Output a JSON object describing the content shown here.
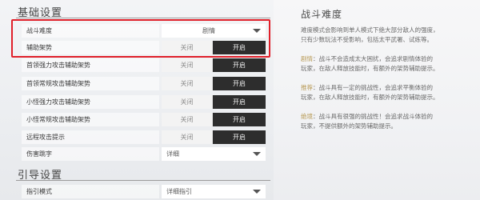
{
  "sections": {
    "basic_title": "基础设置",
    "guide_title": "引导设置"
  },
  "rows": [
    {
      "label": "战斗难度",
      "type": "dropdown",
      "value": "剧情"
    },
    {
      "label": "辅助架势",
      "type": "toggle",
      "off": "关闭",
      "on": "开启",
      "selected": "on"
    },
    {
      "label": "首领强力攻击辅助架势",
      "type": "toggle",
      "off": "关闭",
      "on": "开启",
      "selected": "on"
    },
    {
      "label": "首领常规攻击辅助架势",
      "type": "toggle",
      "off": "关闭",
      "on": "开启",
      "selected": "on"
    },
    {
      "label": "小怪强力攻击辅助架势",
      "type": "toggle",
      "off": "关闭",
      "on": "开启",
      "selected": "on"
    },
    {
      "label": "小怪常规攻击辅助架势",
      "type": "toggle",
      "off": "关闭",
      "on": "开启",
      "selected": "on"
    },
    {
      "label": "远程攻击提示",
      "type": "toggle",
      "off": "关闭",
      "on": "开启",
      "selected": "on"
    },
    {
      "label": "伤害跳字",
      "type": "dropdown",
      "value": "详细"
    }
  ],
  "guide_rows": [
    {
      "label": "指引模式",
      "type": "dropdown",
      "value": "详细指引"
    }
  ],
  "info": {
    "title": "战斗难度",
    "intro_1": "难度模式会影响到单人模式下绝大部分敌人的强度，",
    "intro_2": "只有少数玩法不受影响，包括太平武署、试练等。",
    "p1_label": "剧情",
    "p1_rest": "：战斗不会造成太大困扰，会追求剧情体验的",
    "p1_l2": "玩家，在敌人释放技能时，有额外的架势辅助提示。",
    "p2_label": "推荐",
    "p2_rest": "：战斗具有一定的挑战性，会追求平衡体验的",
    "p2_l2": "玩家，在敌人释放技能时，有额外的架势辅助提示。",
    "p3_label": "绝境",
    "p3_rest": "：战斗具有很强的挑战性！会追求战斗体验的",
    "p3_l2": "玩家，不提供额外的架势辅助提示。"
  },
  "colors": {
    "highlight_border": "#e0202a",
    "toggle_on_bg": "#2d2d2d",
    "info_accent": "#b89a55"
  }
}
